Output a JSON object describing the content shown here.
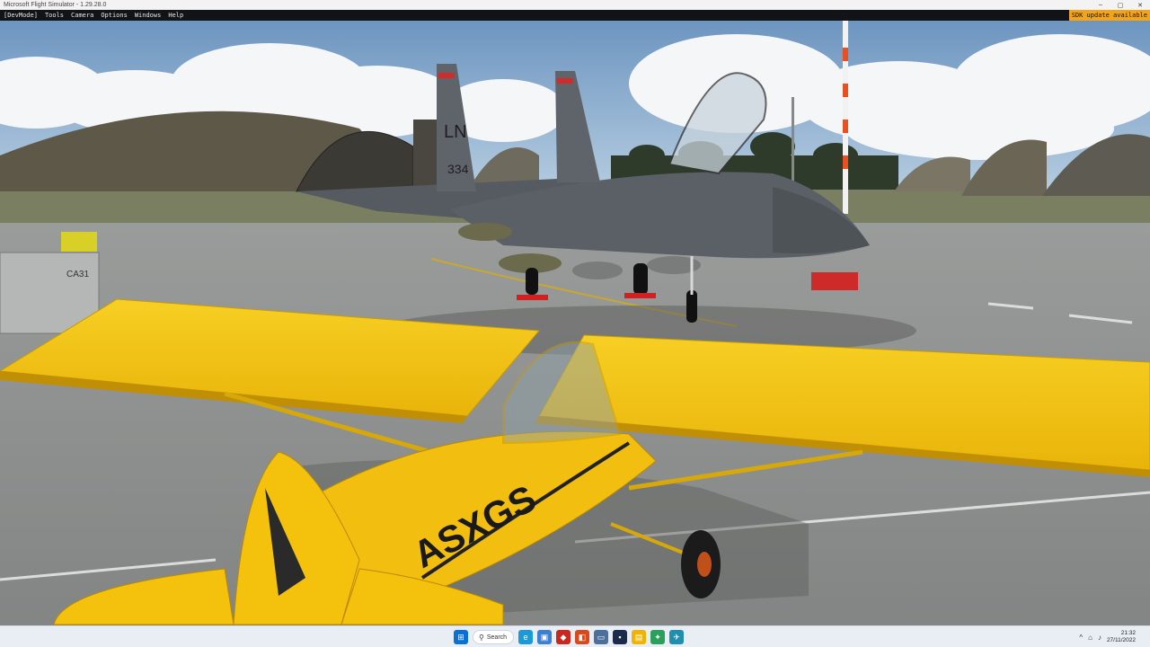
{
  "window": {
    "title": "Microsoft Flight Simulator - 1.29.28.0",
    "minimize_glyph": "–",
    "maximize_glyph": "▢",
    "close_glyph": "✕"
  },
  "devmenu": {
    "items": [
      "[DevMode]",
      "Tools",
      "Camera",
      "Options",
      "Windows",
      "Help"
    ],
    "sdk_notice": "SDK update available",
    "sdk_color": "#f3a51a"
  },
  "scene": {
    "fighter_tail_code": "LN",
    "fighter_tail_number": "334",
    "cart_label": "CA31",
    "cub_registration": "ASXGS",
    "cub_color": "#f4c20d",
    "fighter_color": "#5b6066"
  },
  "taskbar": {
    "search_label": "Search",
    "icons": [
      "start-icon",
      "search-icon",
      "edge-icon",
      "photos-icon",
      "app-red-icon",
      "app-office-icon",
      "app-monitor-icon",
      "app-dark-icon",
      "files-icon",
      "app-green-icon",
      "msfs-icon"
    ],
    "tray_glyphs": [
      "^",
      "⌂",
      "♪"
    ],
    "time": "21:32",
    "date": "27/11/2022"
  }
}
